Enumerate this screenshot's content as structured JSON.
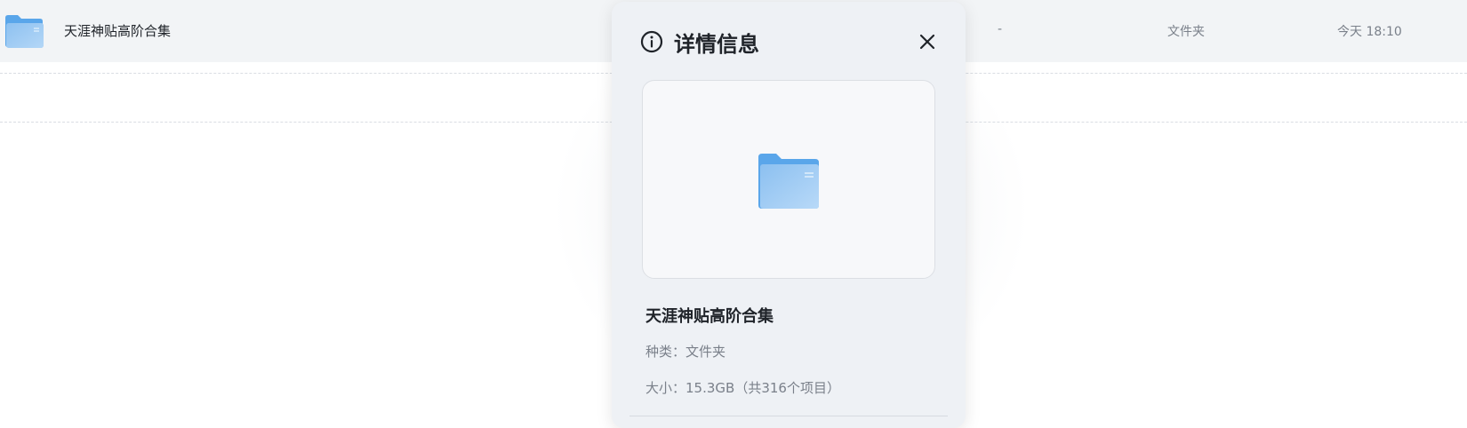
{
  "file_list": {
    "rows": [
      {
        "icon": "folder-icon",
        "name": "天涯神贴高阶合集",
        "size": "-",
        "type": "文件夹",
        "modified": "今天 18:10"
      }
    ]
  },
  "details_panel": {
    "title": "详情信息",
    "title_icon": "info-icon",
    "close_icon": "close-icon",
    "preview_icon": "folder-icon",
    "name": "天涯神贴高阶合集",
    "kind_line": "种类：文件夹",
    "size_line": "大小：15.3GB（共316个项目）"
  },
  "colors": {
    "folder_back": "#5aa6ea",
    "folder_front": "#9ccaf4",
    "selected_row_bg": "#f2f4f6",
    "panel_bg": "#eef1f5"
  }
}
